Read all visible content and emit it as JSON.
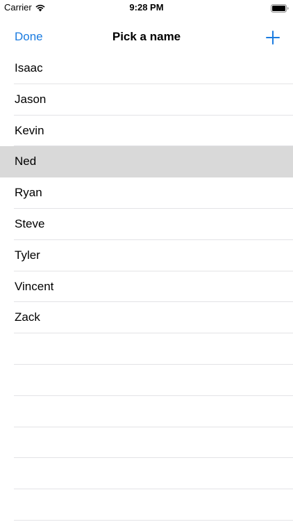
{
  "status_bar": {
    "carrier": "Carrier",
    "time": "9:28 PM",
    "wifi_icon": "wifi-icon",
    "battery_icon": "battery-icon"
  },
  "nav": {
    "done_label": "Done",
    "title": "Pick a name",
    "add_icon": "plus-icon",
    "accent_color": "#1a7be0"
  },
  "list": {
    "names": [
      "Isaac",
      "Jason",
      "Kevin",
      "Ned",
      "Ryan",
      "Steve",
      "Tyler",
      "Vincent",
      "Zack"
    ],
    "selected": "Ned",
    "selected_color": "#d9d9d9",
    "separator_color": "#e3e3e6"
  }
}
